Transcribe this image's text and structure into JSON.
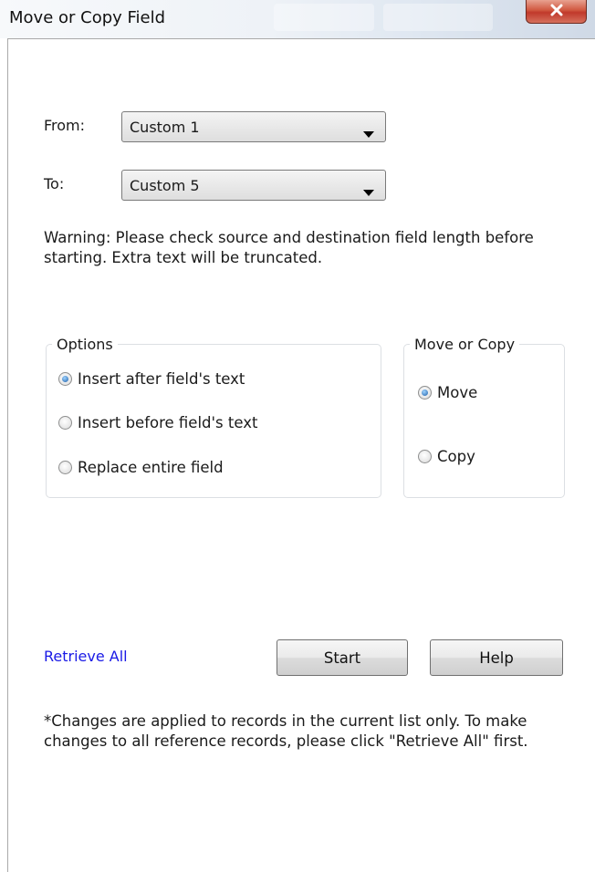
{
  "window": {
    "title": "Move or Copy Field",
    "close_label": "x"
  },
  "from": {
    "label": "From:",
    "value": "Custom 1"
  },
  "to": {
    "label": "To:",
    "value": "Custom 5"
  },
  "warning": "Warning: Please check source and destination field length before starting. Extra text will be truncated.",
  "options": {
    "legend": "Options",
    "items": [
      {
        "label": "Insert after field's text",
        "selected": true
      },
      {
        "label": "Insert before field's text",
        "selected": false
      },
      {
        "label": "Replace entire field",
        "selected": false
      }
    ]
  },
  "move_copy": {
    "legend": "Move or Copy",
    "items": [
      {
        "label": "Move",
        "selected": true
      },
      {
        "label": "Copy",
        "selected": false
      }
    ]
  },
  "retrieve_all": "Retrieve All",
  "buttons": {
    "start": "Start",
    "help": "Help"
  },
  "note": "*Changes are applied to records in the current list only. To make changes to all reference records, please click \"Retrieve All\" first.",
  "colors": {
    "link": "#1a1ae6",
    "close_button": "#c0392b",
    "radio_selected": "#1d5fa8"
  }
}
